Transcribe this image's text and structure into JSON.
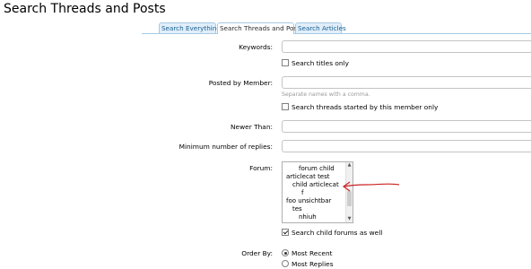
{
  "page": {
    "title": "Search Threads and Posts"
  },
  "tabs": [
    {
      "label": "Search Everything",
      "active": false
    },
    {
      "label": "Search Threads and Posts",
      "active": true
    },
    {
      "label": "Search Articles",
      "active": false
    }
  ],
  "form": {
    "keywords": {
      "label": "Keywords:",
      "value": ""
    },
    "search_titles_only": {
      "label": "Search titles only",
      "checked": false
    },
    "posted_by_member": {
      "label": "Posted by Member:",
      "value": "",
      "hint": "Separate names with a comma."
    },
    "search_started_by_member": {
      "label": "Search threads started by this member only",
      "checked": false
    },
    "newer_than": {
      "label": "Newer Than:",
      "value": ""
    },
    "min_replies": {
      "label": "Minimum number of replies:",
      "value": ""
    },
    "forum": {
      "label": "Forum:",
      "options": [
        "forum child",
        "articlecat test",
        "child articlecat",
        "f",
        "foo unsichtbar",
        "tes",
        "nhiuh"
      ]
    },
    "search_child_forums": {
      "label": "Search child forums as well",
      "checked": true
    },
    "order_by": {
      "label": "Order By:",
      "options": [
        {
          "label": "Most Recent",
          "selected": true
        },
        {
          "label": "Most Replies",
          "selected": false
        }
      ]
    }
  },
  "colors": {
    "tab_border": "#a5cae4",
    "tab_bg": "#e1eefa",
    "tab_text": "#176093",
    "annotation": "#cc2222"
  }
}
